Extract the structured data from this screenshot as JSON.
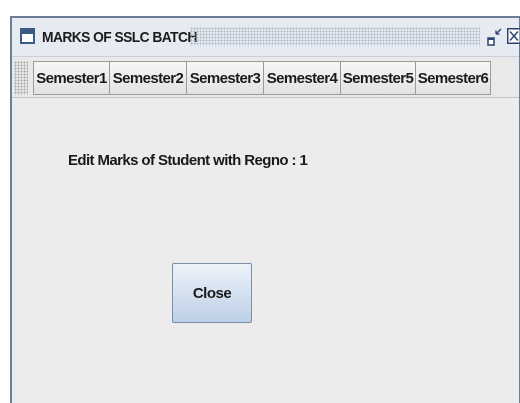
{
  "window": {
    "title": "MARKS OF SSLC BATCH",
    "restore_icon": "restore-window-icon",
    "close_icon": "close-window-icon"
  },
  "tabs": [
    {
      "label": "Semester1"
    },
    {
      "label": "Semester2"
    },
    {
      "label": "Semester3"
    },
    {
      "label": "Semester4"
    },
    {
      "label": "Semester5"
    },
    {
      "label": "Semester6"
    }
  ],
  "main": {
    "heading": "Edit Marks of Student with Regno : 1",
    "close_label": "Close"
  },
  "colors": {
    "border": "#6b7e98",
    "titlebar": "#e6ebf2",
    "panel": "#ececec",
    "button_top": "#eef3fa",
    "button_bottom": "#bccfe6"
  }
}
